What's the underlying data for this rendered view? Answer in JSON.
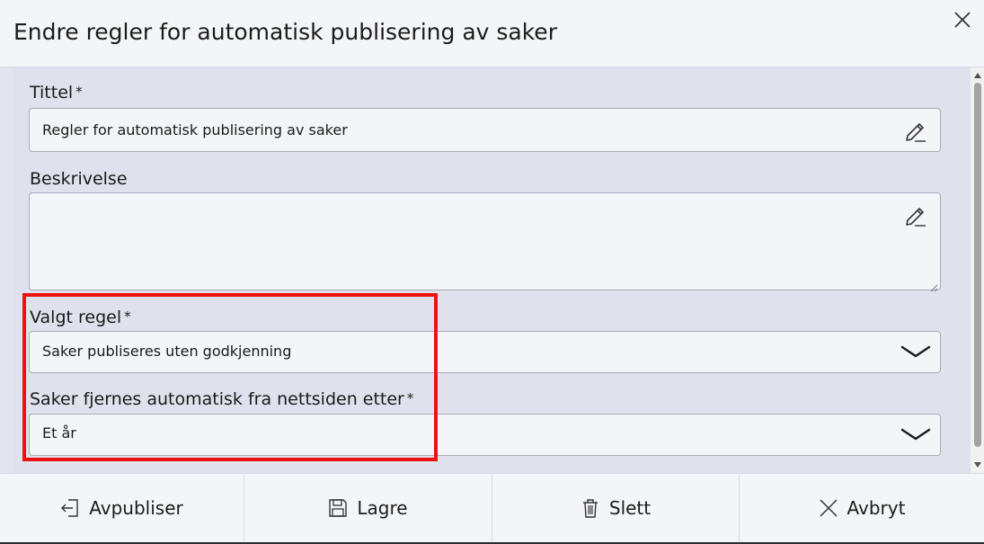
{
  "dialog": {
    "title": "Endre regler for automatisk publisering av saker"
  },
  "form": {
    "title_field": {
      "label": "Tittel",
      "required_mark": "*",
      "value": "Regler for automatisk publisering av saker"
    },
    "description_field": {
      "label": "Beskrivelse",
      "value": ""
    },
    "rule_field": {
      "label": "Valgt regel",
      "required_mark": "*",
      "selected": "Saker publiseres uten godkjenning"
    },
    "removal_field": {
      "label": "Saker fjernes automatisk fra nettsiden etter",
      "required_mark": "*",
      "selected": "Et år"
    }
  },
  "footer": {
    "unpublish_label": "Avpubliser",
    "save_label": "Lagre",
    "delete_label": "Slett",
    "cancel_label": "Avbryt"
  },
  "icons": {
    "close": "close-icon",
    "edit": "pencil-icon",
    "dropdown": "chevron-down-icon",
    "unpublish": "logout-icon",
    "save": "floppy-disk-icon",
    "delete": "trash-icon",
    "cancel": "x-icon"
  },
  "colors": {
    "highlight": "#ee1111",
    "form_background": "#dfe1ec",
    "field_background": "#f4f5f9"
  }
}
